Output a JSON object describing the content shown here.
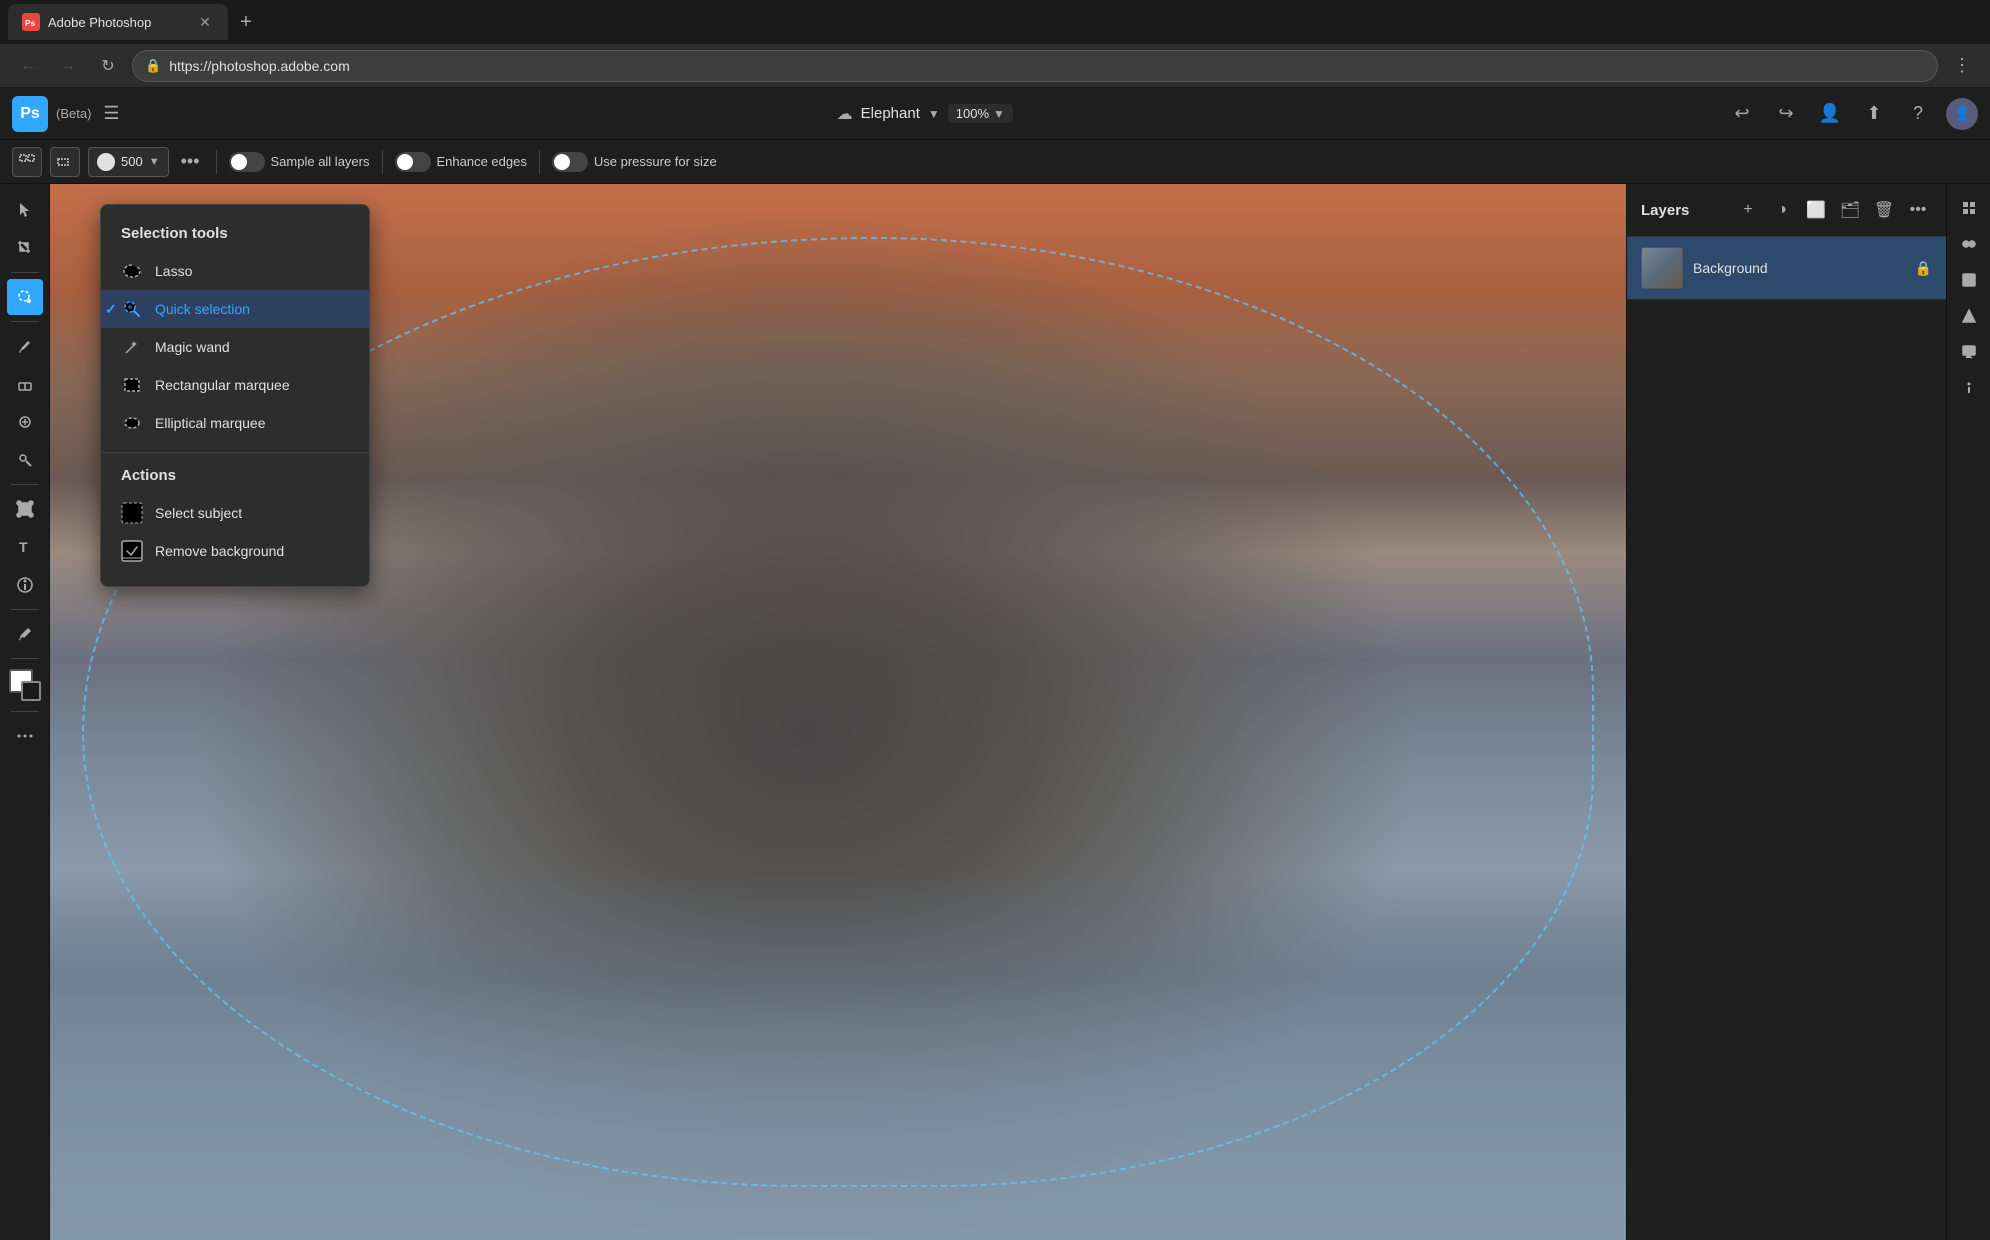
{
  "browser": {
    "tab_title": "Adobe Photoshop",
    "tab_favicon_text": "Ps",
    "url": "https://photoshop.adobe.com",
    "new_tab_label": "+",
    "close_tab_label": "✕"
  },
  "app": {
    "title": "Adobe Photoshop",
    "beta_label": "(Beta)",
    "doc_name": "Elephant",
    "zoom": "100%",
    "logo_text": "Ps"
  },
  "toolbar": {
    "brush_size": "500",
    "more_label": "•••",
    "sample_all_layers_label": "Sample all layers",
    "enhance_edges_label": "Enhance edges",
    "use_pressure_label": "Use pressure for size"
  },
  "selection_menu": {
    "section_title": "Selection tools",
    "items": [
      {
        "label": "Lasso",
        "active": false
      },
      {
        "label": "Quick selection",
        "active": true
      },
      {
        "label": "Magic wand",
        "active": false
      },
      {
        "label": "Rectangular marquee",
        "active": false
      },
      {
        "label": "Elliptical marquee",
        "active": false
      }
    ],
    "actions_title": "Actions",
    "actions": [
      {
        "label": "Select subject"
      },
      {
        "label": "Remove background"
      }
    ]
  },
  "layers": {
    "title": "Layers",
    "items": [
      {
        "name": "Background",
        "locked": true
      }
    ],
    "buttons": {
      "add": "+",
      "filter": "◑",
      "mask": "⬜",
      "group": "🗂",
      "delete": "🗑",
      "more": "•••"
    }
  }
}
